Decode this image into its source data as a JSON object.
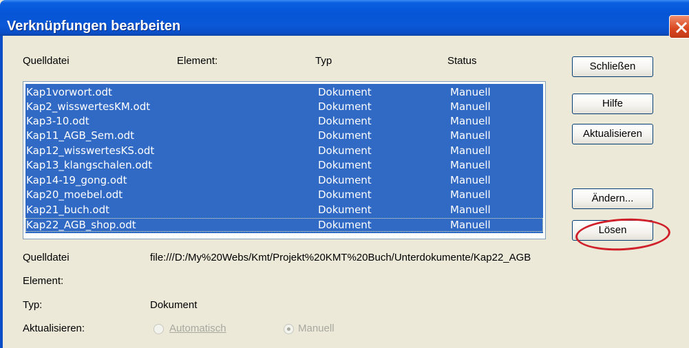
{
  "window": {
    "title": "Verknüpfungen bearbeiten"
  },
  "columns": {
    "source": "Quelldatei",
    "element": "Element:",
    "type": "Typ",
    "status": "Status"
  },
  "links": [
    {
      "name": "Kap1vorwort.odt",
      "type": "Dokument",
      "status": "Manuell"
    },
    {
      "name": "Kap2_wisswertesKM.odt",
      "type": "Dokument",
      "status": "Manuell"
    },
    {
      "name": "Kap3-10.odt",
      "type": "Dokument",
      "status": "Manuell"
    },
    {
      "name": "Kap11_AGB_Sem.odt",
      "type": "Dokument",
      "status": "Manuell"
    },
    {
      "name": "Kap12_wisswertesKS.odt",
      "type": "Dokument",
      "status": "Manuell"
    },
    {
      "name": "Kap13_klangschalen.odt",
      "type": "Dokument",
      "status": "Manuell"
    },
    {
      "name": "Kap14-19_gong.odt",
      "type": "Dokument",
      "status": "Manuell"
    },
    {
      "name": "Kap20_moebel.odt",
      "type": "Dokument",
      "status": "Manuell"
    },
    {
      "name": "Kap21_buch.odt",
      "type": "Dokument",
      "status": "Manuell"
    },
    {
      "name": "Kap22_AGB_shop.odt",
      "type": "Dokument",
      "status": "Manuell"
    }
  ],
  "buttons": {
    "close": "Schließen",
    "help": "Hilfe",
    "update": "Aktualisieren",
    "modify": "Ändern...",
    "break": "Lösen"
  },
  "details": {
    "source_label": "Quelldatei",
    "source_value": "file:///D:/My%20Webs/Kmt/Projekt%20KMT%20Buch/Unterdokumente/Kap22_AGB",
    "element_label": "Element:",
    "type_label": "Typ:",
    "type_value": "Dokument",
    "update_label": "Aktualisieren:",
    "auto_label": "Automatisch",
    "manual_label": "Manuell"
  },
  "colors": {
    "selection": "#316ac5",
    "annotation": "#d0202a",
    "title_bar": "#0555d6"
  }
}
